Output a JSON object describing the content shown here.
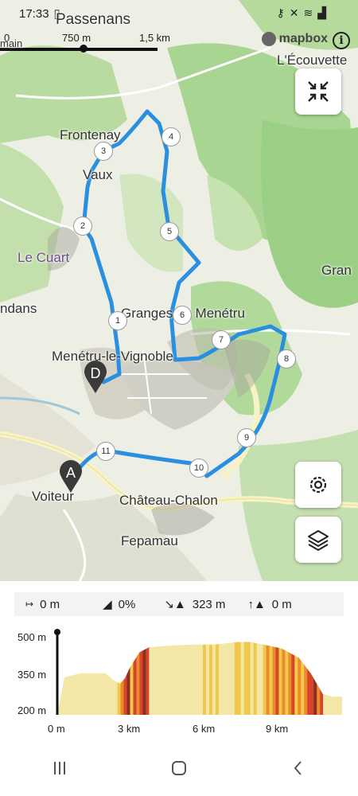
{
  "status_bar": {
    "time": "17:33"
  },
  "scale": {
    "zero": "0",
    "mid": "750 m",
    "end": "1,5 km"
  },
  "mapbox": {
    "label": "mapbox"
  },
  "places": {
    "passenans": "Passenans",
    "ecouvette": "L'Écouvette",
    "frontenay": "Frontenay",
    "vaux": "Vaux",
    "le_cuart": "Le Cuart",
    "gran": "Gran",
    "ndans": "ndans",
    "granges": "Granges de Menétru",
    "menetru": "Menétru-le-Vignoble",
    "voiteur": "Voiteur",
    "chateau": "Château-Chalon",
    "fepamau": "Fepamau",
    "main": "main"
  },
  "waypoints": [
    "1",
    "2",
    "3",
    "4",
    "5",
    "6",
    "7",
    "8",
    "9",
    "10",
    "11"
  ],
  "markers": {
    "start": "A",
    "end": "D"
  },
  "stats": {
    "distance": "0 m",
    "grade": "0%",
    "descent": "323 m",
    "ascent": "0 m"
  },
  "chart_data": {
    "type": "area",
    "title": "",
    "xlabel": "",
    "ylabel": "",
    "x_ticks": [
      "0 m",
      "3 km",
      "6 km",
      "9 km"
    ],
    "y_ticks": [
      "500 m",
      "350 m",
      "200 m"
    ],
    "ylim": [
      200,
      500
    ],
    "xlim": [
      0,
      11.8
    ],
    "x": [
      0,
      0.3,
      1.0,
      2.0,
      2.3,
      2.6,
      2.8,
      3.0,
      3.4,
      3.8,
      4.5,
      5.5,
      6.5,
      7.5,
      8.0,
      8.8,
      9.3,
      10.0,
      10.5,
      11.0,
      11.4,
      11.8
    ],
    "series": [
      {
        "values": [
          200,
          345,
          360,
          360,
          335,
          320,
          340,
          380,
          440,
          460,
          465,
          470,
          470,
          480,
          480,
          465,
          455,
          420,
          360,
          280,
          270,
          270
        ]
      }
    ],
    "grade_colors": [
      "#f3e7a7",
      "#f0c94a",
      "#ea8b2c",
      "#d6452b",
      "#8c2f1e"
    ]
  }
}
